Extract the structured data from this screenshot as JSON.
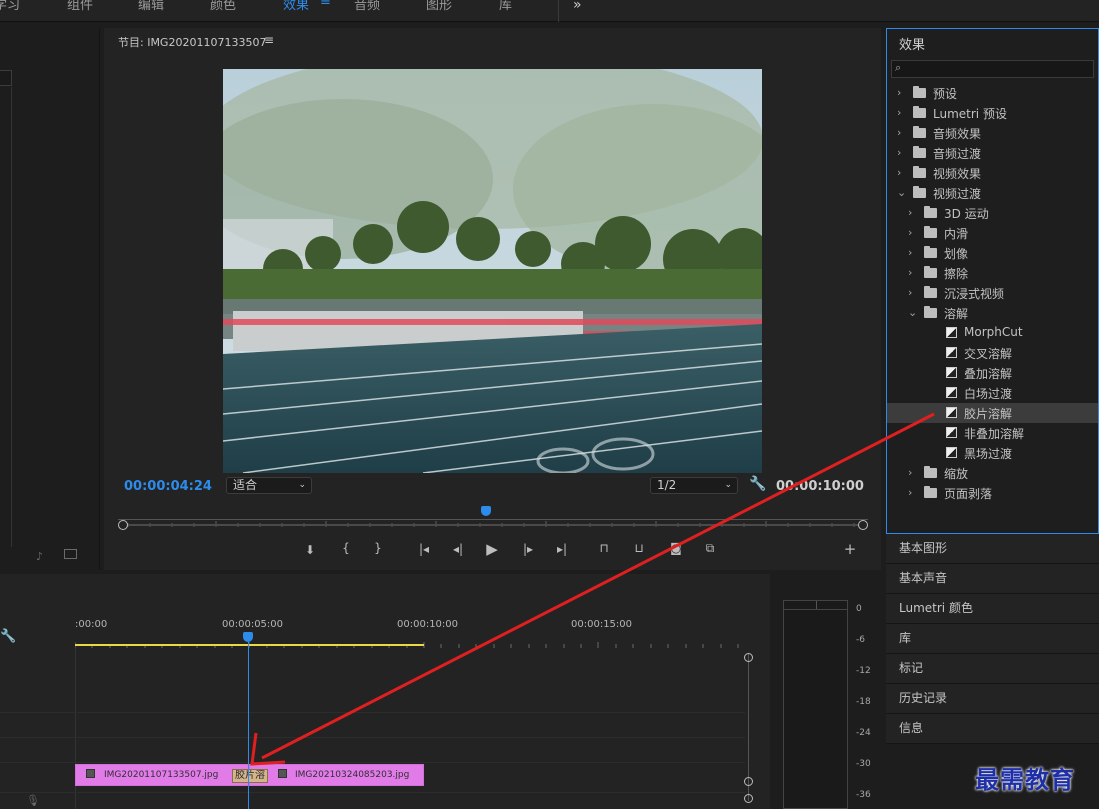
{
  "workspaces": [
    {
      "label": "学习",
      "active": false
    },
    {
      "label": "组件",
      "active": false
    },
    {
      "label": "编辑",
      "active": false
    },
    {
      "label": "颜色",
      "active": false
    },
    {
      "label": "效果",
      "active": true
    },
    {
      "label": "音频",
      "active": false
    },
    {
      "label": "图形",
      "active": false
    },
    {
      "label": "库",
      "active": false
    }
  ],
  "program": {
    "title": "节目: IMG20201107133507",
    "timecode_current": "00:00:04:24",
    "zoom_select": "适合",
    "resolution_select": "1/2",
    "timecode_duration": "00:00:10:00",
    "playhead_fraction": 0.49
  },
  "effects_panel": {
    "title": "效果",
    "tree": [
      {
        "label": "预设",
        "level": 0,
        "kind": "preset-folder",
        "expanded": false
      },
      {
        "label": "Lumetri 预设",
        "level": 0,
        "kind": "preset-folder",
        "expanded": false
      },
      {
        "label": "音频效果",
        "level": 0,
        "kind": "folder",
        "expanded": false
      },
      {
        "label": "音频过渡",
        "level": 0,
        "kind": "folder",
        "expanded": false
      },
      {
        "label": "视频效果",
        "level": 0,
        "kind": "folder",
        "expanded": false
      },
      {
        "label": "视频过渡",
        "level": 0,
        "kind": "folder",
        "expanded": true
      },
      {
        "label": "3D 运动",
        "level": 1,
        "kind": "folder",
        "expanded": false
      },
      {
        "label": "内滑",
        "level": 1,
        "kind": "folder",
        "expanded": false
      },
      {
        "label": "划像",
        "level": 1,
        "kind": "folder",
        "expanded": false
      },
      {
        "label": "擦除",
        "level": 1,
        "kind": "folder",
        "expanded": false
      },
      {
        "label": "沉浸式视频",
        "level": 1,
        "kind": "folder",
        "expanded": false
      },
      {
        "label": "溶解",
        "level": 1,
        "kind": "folder",
        "expanded": true
      },
      {
        "label": "MorphCut",
        "level": 2,
        "kind": "transition",
        "expanded": false
      },
      {
        "label": "交叉溶解",
        "level": 2,
        "kind": "transition",
        "expanded": false
      },
      {
        "label": "叠加溶解",
        "level": 2,
        "kind": "transition",
        "expanded": false
      },
      {
        "label": "白场过渡",
        "level": 2,
        "kind": "transition",
        "expanded": false
      },
      {
        "label": "胶片溶解",
        "level": 2,
        "kind": "transition",
        "expanded": false,
        "selected": true
      },
      {
        "label": "非叠加溶解",
        "level": 2,
        "kind": "transition",
        "expanded": false
      },
      {
        "label": "黑场过渡",
        "level": 2,
        "kind": "transition",
        "expanded": false
      },
      {
        "label": "缩放",
        "level": 1,
        "kind": "folder",
        "expanded": false
      },
      {
        "label": "页面剥落",
        "level": 1,
        "kind": "folder",
        "expanded": false
      }
    ]
  },
  "right_panels": [
    "基本图形",
    "基本声音",
    "Lumetri 颜色",
    "库",
    "标记",
    "历史记录",
    "信息"
  ],
  "timeline": {
    "ruler": [
      ":00:00",
      "00:00:05:00",
      "00:00:10:00",
      "00:00:15:00"
    ],
    "clip1": "IMG20201107133507.jpg",
    "transition": "胶片溶",
    "clip2": "IMG20210324085203.jpg"
  },
  "meter_scale": [
    "0",
    "-6",
    "-12",
    "-18",
    "-24",
    "-30",
    "-36"
  ],
  "watermark": "最需教育",
  "colors": {
    "accent": "#2d8ceb",
    "clip": "#e07be8",
    "arrow": "#e02020",
    "in_out_bar": "#e8d84a"
  }
}
